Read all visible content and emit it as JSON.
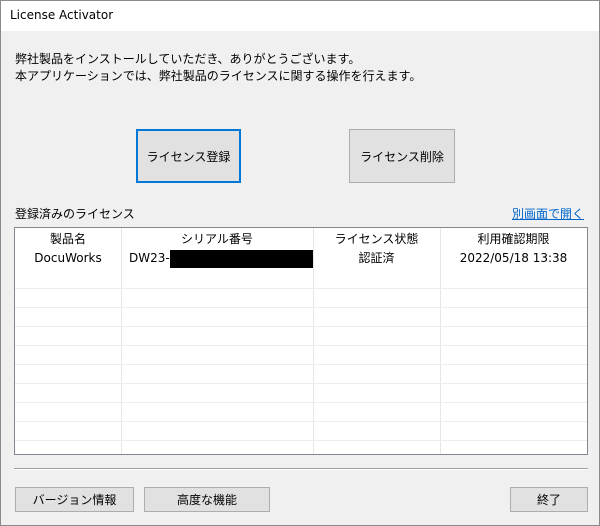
{
  "window": {
    "title": "License Activator"
  },
  "intro": {
    "line1": "弊社製品をインストールしていただき、ありがとうございます。",
    "line2": "本アプリケーションでは、弊社製品のライセンスに関する操作を行えます。"
  },
  "buttons": {
    "register": "ライセンス登録",
    "remove": "ライセンス削除",
    "version": "バージョン情報",
    "advanced": "高度な機能",
    "exit": "終了"
  },
  "licenses": {
    "label": "登録済みのライセンス",
    "open_link": "別画面で開く",
    "columns": [
      "製品名",
      "シリアル番号",
      "ライセンス状態",
      "利用確認期限"
    ],
    "rows": [
      {
        "product": "DocuWorks",
        "serial_prefix": "DW23-",
        "status": "認証済",
        "expiry": "2022/05/18 13:38"
      }
    ]
  }
}
